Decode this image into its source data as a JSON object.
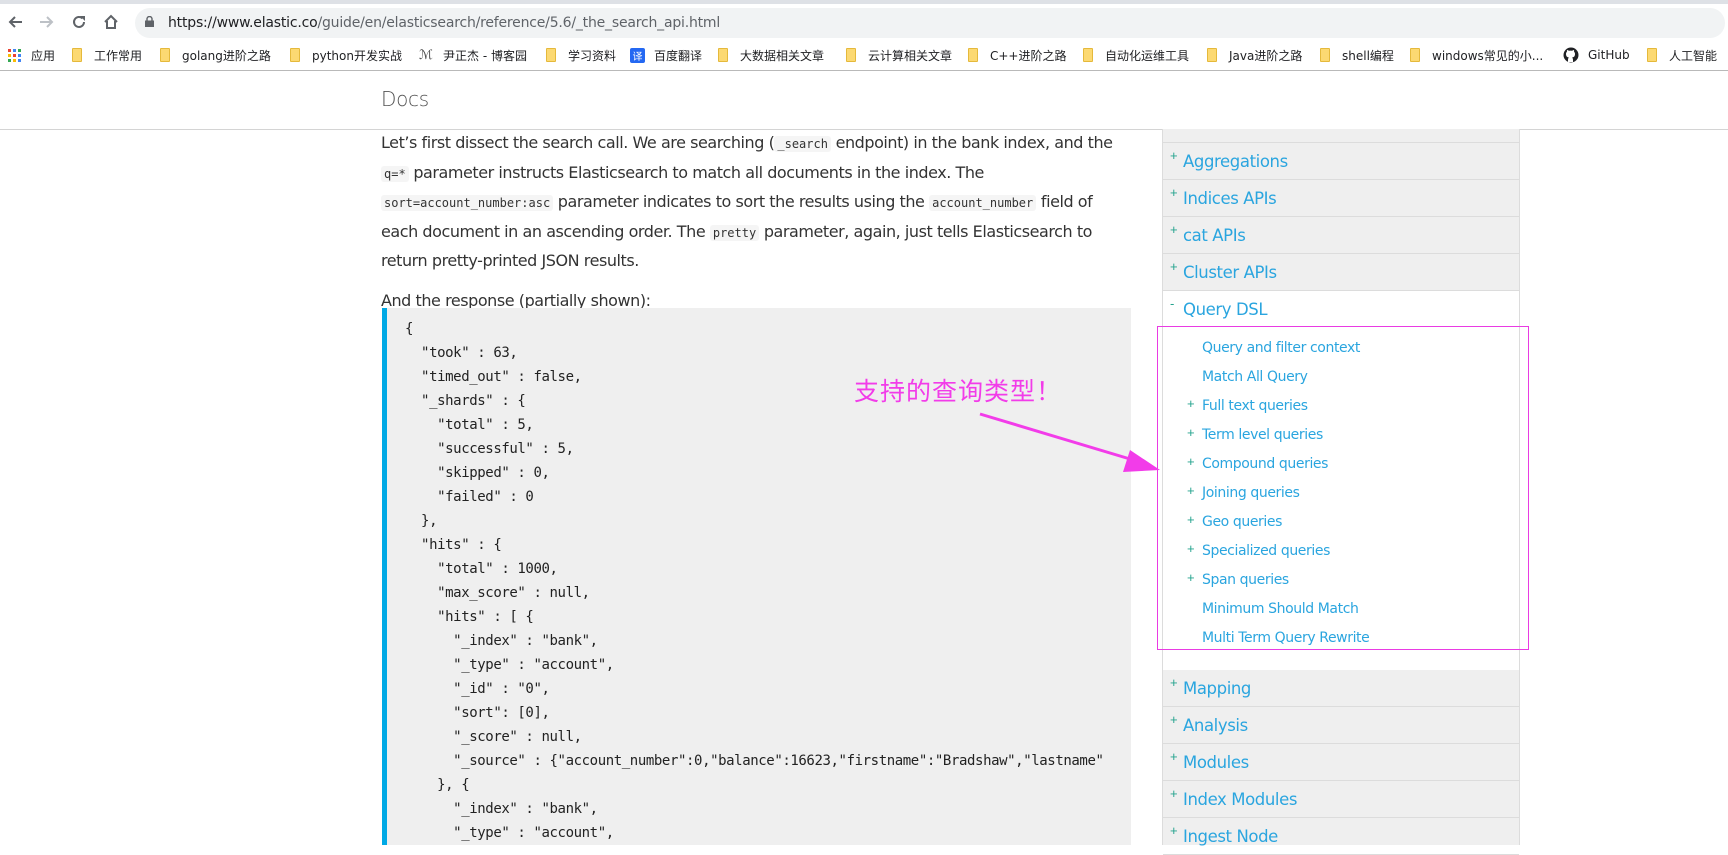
{
  "browser": {
    "nav": {
      "back_icon": "arrow-left-icon",
      "forward_icon": "arrow-right-icon",
      "reload_icon": "reload-icon",
      "home_icon": "home-icon"
    },
    "url_host": "https://www.elastic.co",
    "url_path": "/guide/en/elasticsearch/reference/5.6/_the_search_api.html",
    "bookmarks": [
      {
        "label": "应用",
        "icon": "apps-grid-icon"
      },
      {
        "label": "工作常用",
        "icon": "folder-icon"
      },
      {
        "label": "golang进阶之路",
        "icon": "folder-icon"
      },
      {
        "label": "python开发实战",
        "icon": "folder-icon"
      },
      {
        "label": "尹正杰 - 博客园",
        "icon": "cnblogs-icon"
      },
      {
        "label": "学习资料",
        "icon": "folder-icon"
      },
      {
        "label": "百度翻译",
        "icon": "translate-icon"
      },
      {
        "label": "大数据相关文章",
        "icon": "folder-icon"
      },
      {
        "label": "云计算相关文章",
        "icon": "folder-icon"
      },
      {
        "label": "C++进阶之路",
        "icon": "folder-icon"
      },
      {
        "label": "自动化运维工具",
        "icon": "folder-icon"
      },
      {
        "label": "Java进阶之路",
        "icon": "folder-icon"
      },
      {
        "label": "shell编程",
        "icon": "folder-icon"
      },
      {
        "label": "windows常见的小...",
        "icon": "folder-icon"
      },
      {
        "label": "GitHub",
        "icon": "github-icon"
      },
      {
        "label": "人工智能",
        "icon": "folder-icon"
      }
    ]
  },
  "header": {
    "title": "Docs"
  },
  "content": {
    "para1": [
      {
        "t": "text",
        "v": "Let’s first dissect the search call. We are searching ("
      },
      {
        "t": "code",
        "v": "_search"
      },
      {
        "t": "text",
        "v": " endpoint) in the bank index, and the "
      },
      {
        "t": "code",
        "v": "q=*"
      },
      {
        "t": "text",
        "v": " parameter instructs Elasticsearch to match all documents in the index. The "
      },
      {
        "t": "code",
        "v": "sort=account_number:asc"
      },
      {
        "t": "text",
        "v": " parameter indicates to sort the results using the "
      },
      {
        "t": "code",
        "v": "account_number"
      },
      {
        "t": "text",
        "v": " field of each document in an ascending order. The "
      },
      {
        "t": "code",
        "v": "pretty"
      },
      {
        "t": "text",
        "v": " parameter, again, just tells Elasticsearch to return pretty-printed JSON results."
      }
    ],
    "para2": "And the response (partially shown):",
    "code_lines": [
      "{",
      "  \"took\" : 63,",
      "  \"timed_out\" : false,",
      "  \"_shards\" : {",
      "    \"total\" : 5,",
      "    \"successful\" : 5,",
      "    \"skipped\" : 0,",
      "    \"failed\" : 0",
      "  },",
      "  \"hits\" : {",
      "    \"total\" : 1000,",
      "    \"max_score\" : null,",
      "    \"hits\" : [ {",
      "      \"_index\" : \"bank\",",
      "      \"_type\" : \"account\",",
      "      \"_id\" : \"0\",",
      "      \"sort\": [0],",
      "      \"_score\" : null,",
      "      \"_source\" : {\"account_number\":0,\"balance\":16623,\"firstname\":\"Bradshaw\",\"lastname\"",
      "    }, {",
      "      \"_index\" : \"bank\",",
      "      \"_type\" : \"account\","
    ]
  },
  "sidebar": {
    "items_before": [
      {
        "sign": "+",
        "label": "Aggregations"
      },
      {
        "sign": "+",
        "label": "Indices APIs"
      },
      {
        "sign": "+",
        "label": "cat APIs"
      },
      {
        "sign": "+",
        "label": "Cluster APIs"
      }
    ],
    "open_item": {
      "sign": "-",
      "label": "Query DSL"
    },
    "sub_items": [
      {
        "sign": "",
        "label": "Query and filter context"
      },
      {
        "sign": "",
        "label": "Match All Query"
      },
      {
        "sign": "+",
        "label": "Full text queries"
      },
      {
        "sign": "+",
        "label": "Term level queries"
      },
      {
        "sign": "+",
        "label": "Compound queries"
      },
      {
        "sign": "+",
        "label": "Joining queries"
      },
      {
        "sign": "+",
        "label": "Geo queries"
      },
      {
        "sign": "+",
        "label": "Specialized queries"
      },
      {
        "sign": "+",
        "label": "Span queries"
      },
      {
        "sign": "",
        "label": "Minimum Should Match"
      },
      {
        "sign": "",
        "label": "Multi Term Query Rewrite"
      }
    ],
    "items_after": [
      {
        "sign": "+",
        "label": "Mapping"
      },
      {
        "sign": "+",
        "label": "Analysis"
      },
      {
        "sign": "+",
        "label": "Modules"
      },
      {
        "sign": "+",
        "label": "Index Modules"
      },
      {
        "sign": "+",
        "label": "Ingest Node"
      }
    ]
  },
  "annotation": {
    "text": "支持的查询类型！",
    "color": "#f23ce9"
  },
  "colors": {
    "link": "#2aa5df",
    "sign": "#25a38e",
    "code_border": "#00a9e5"
  }
}
